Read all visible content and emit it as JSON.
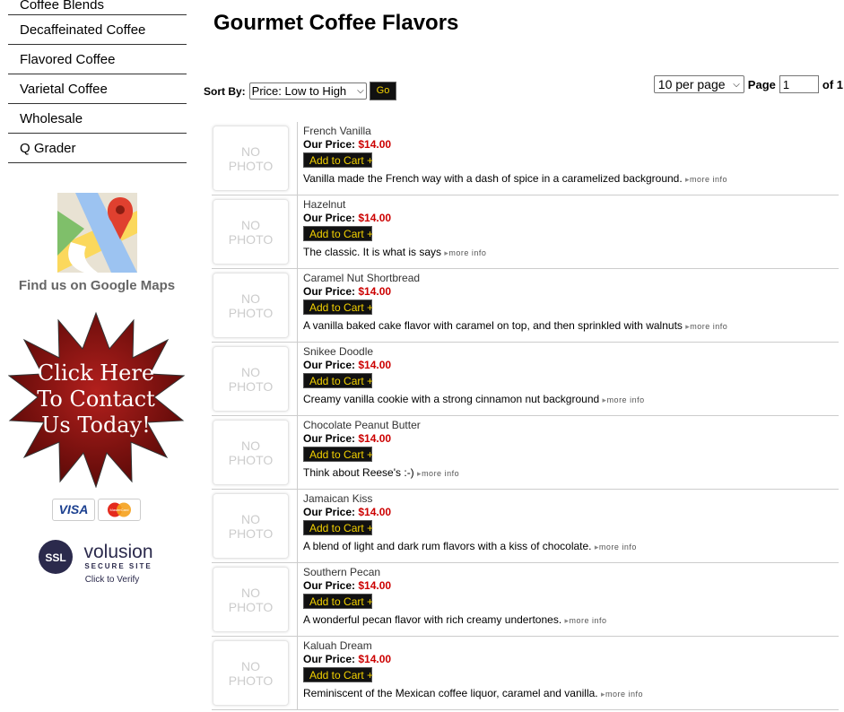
{
  "sidebar": {
    "categories": [
      "Coffee Blends",
      "Decaffeinated Coffee",
      "Flavored Coffee",
      "Varietal Coffee",
      "Wholesale",
      "Q Grader"
    ],
    "maps_label": "Find us on Google Maps",
    "contact_lines": [
      "Click Here",
      "To Contact",
      "Us Today!"
    ],
    "cards": [
      "VISA",
      "MasterCard"
    ],
    "ssl": {
      "badge": "SSL",
      "brand": "volusion",
      "line": "SECURE SITE",
      "verify": "Click to Verify"
    }
  },
  "main": {
    "title": "Gourmet Coffee Flavors",
    "sort_label": "Sort By:",
    "sort_value": "Price: Low to High",
    "go_label": "Go",
    "per_page": "10 per page",
    "page_label": "Page",
    "page_value": "1",
    "of_label": "of 1"
  },
  "products": [
    {
      "name": "French Vanilla",
      "price_label": "Our Price:",
      "price": "$14.00",
      "cart": "Add to Cart",
      "desc": "Vanilla made the French way with a dash of spice in a caramelized background.",
      "more": "more info"
    },
    {
      "name": "Hazelnut",
      "price_label": "Our Price:",
      "price": "$14.00",
      "cart": "Add to Cart",
      "desc": "The classic. It is what is says",
      "more": "more info"
    },
    {
      "name": "Caramel Nut Shortbread",
      "price_label": "Our Price:",
      "price": "$14.00",
      "cart": "Add to Cart",
      "desc": "A vanilla baked cake flavor with caramel on top, and then sprinkled with walnuts",
      "more": "more info"
    },
    {
      "name": "Snikee Doodle",
      "price_label": "Our Price:",
      "price": "$14.00",
      "cart": "Add to Cart",
      "desc": "Creamy vanilla cookie with a strong cinnamon nut background",
      "more": "more info"
    },
    {
      "name": "Chocolate Peanut Butter",
      "price_label": "Our Price:",
      "price": "$14.00",
      "cart": "Add to Cart",
      "desc": "Think about Reese's :-)",
      "more": "more info"
    },
    {
      "name": "Jamaican Kiss",
      "price_label": "Our Price:",
      "price": "$14.00",
      "cart": "Add to Cart",
      "desc": "A blend of light and dark rum flavors with a kiss of chocolate.",
      "more": "more info"
    },
    {
      "name": "Southern Pecan",
      "price_label": "Our Price:",
      "price": "$14.00",
      "cart": "Add to Cart",
      "desc": "A wonderful pecan flavor with rich creamy undertones.",
      "more": "more info"
    },
    {
      "name": "Kaluah Dream",
      "price_label": "Our Price:",
      "price": "$14.00",
      "cart": "Add to Cart",
      "desc": "Reminiscent of the Mexican coffee liquor, caramel and vanilla.",
      "more": "more info"
    }
  ],
  "no_photo": [
    "NO",
    "PHOTO"
  ]
}
